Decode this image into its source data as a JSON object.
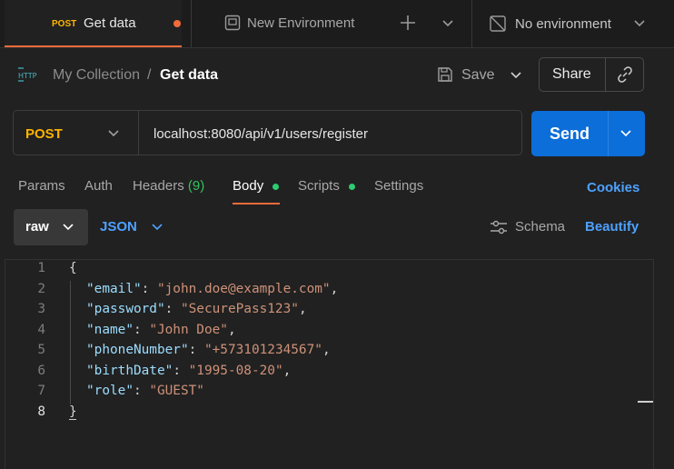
{
  "tabs": {
    "active": {
      "method": "POST",
      "label": "Get data"
    },
    "second": {
      "label": "New Environment"
    },
    "environment": {
      "label": "No environment"
    }
  },
  "header": {
    "breadcrumb_parent": "My Collection",
    "separator": "/",
    "title": "Get data",
    "save_label": "Save",
    "share_label": "Share",
    "http_icon_text": "HTTP"
  },
  "request": {
    "method": "POST",
    "url": "localhost:8080/api/v1/users/register",
    "send_label": "Send"
  },
  "subtabs": {
    "params": "Params",
    "auth": "Auth",
    "headers": "Headers",
    "headers_count": "(9)",
    "body": "Body",
    "scripts": "Scripts",
    "settings": "Settings",
    "cookies": "Cookies"
  },
  "body_toolbar": {
    "mode": "raw",
    "format": "JSON",
    "schema": "Schema",
    "beautify": "Beautify"
  },
  "editor": {
    "line_numbers": [
      "1",
      "2",
      "3",
      "4",
      "5",
      "6",
      "7",
      "8"
    ],
    "open_brace": "{",
    "close_brace": "}",
    "fields": [
      {
        "key": "\"email\"",
        "value": "\"john.doe@example.com\"",
        "comma": ","
      },
      {
        "key": "\"password\"",
        "value": "\"SecurePass123\"",
        "comma": ","
      },
      {
        "key": "\"name\"",
        "value": "\"John Doe\"",
        "comma": ","
      },
      {
        "key": "\"phoneNumber\"",
        "value": "\"+573101234567\"",
        "comma": ","
      },
      {
        "key": "\"birthDate\"",
        "value": "\"1995-08-20\"",
        "comma": ","
      },
      {
        "key": "\"role\"",
        "value": "\"GUEST\"",
        "comma": ""
      }
    ]
  },
  "colors": {
    "accent_orange": "#f26b3a",
    "method_post": "#ffb400",
    "send_blue": "#0c6ed9",
    "link_blue": "#4ea1ff",
    "status_green": "#2ecc71"
  }
}
